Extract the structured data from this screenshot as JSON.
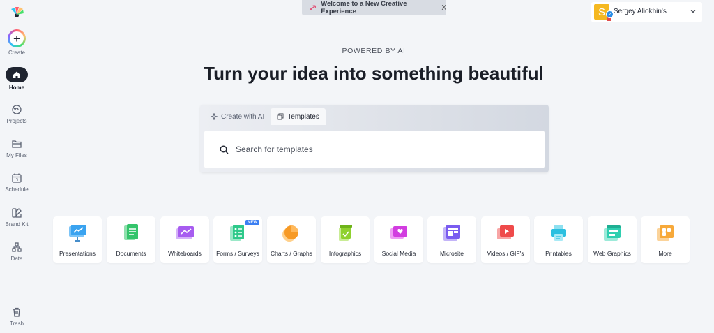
{
  "sidebar": {
    "items": [
      {
        "label": "Create",
        "icon": "plus-circle-icon"
      },
      {
        "label": "Home",
        "icon": "home-icon",
        "active": true
      },
      {
        "label": "Projects",
        "icon": "projects-icon"
      },
      {
        "label": "My Files",
        "icon": "folder-icon"
      },
      {
        "label": "Schedule",
        "icon": "calendar-icon"
      },
      {
        "label": "Brand Kit",
        "icon": "brand-kit-icon"
      },
      {
        "label": "Data",
        "icon": "data-icon"
      },
      {
        "label": "Trash",
        "icon": "trash-icon"
      }
    ]
  },
  "banner": {
    "text": "Welcome to a New Creative Experience",
    "close": "X"
  },
  "user": {
    "initial": "S",
    "name": "Sergey Aliokhin's"
  },
  "hero": {
    "powered_by": "POWERED BY AI",
    "title": "Turn your idea into something beautiful"
  },
  "search": {
    "tabs": [
      {
        "label": "Create with AI",
        "icon": "sparkle-icon"
      },
      {
        "label": "Templates",
        "icon": "templates-icon",
        "active": true
      }
    ],
    "placeholder": "Search for templates"
  },
  "categories": [
    {
      "label": "Presentations",
      "icon": "presentation-icon",
      "color": "#3aa3f0"
    },
    {
      "label": "Documents",
      "icon": "document-icon",
      "color": "#34c46b"
    },
    {
      "label": "Whiteboards",
      "icon": "whiteboard-icon",
      "color": "#a75cf0"
    },
    {
      "label": "Forms / Surveys",
      "icon": "form-icon",
      "color": "#2ec98a",
      "badge": "NEW"
    },
    {
      "label": "Charts / Graphs",
      "icon": "chart-icon",
      "color": "#f79a25"
    },
    {
      "label": "Infographics",
      "icon": "infographic-icon",
      "color": "#8fd12f"
    },
    {
      "label": "Social Media",
      "icon": "social-media-icon",
      "color": "#d23de0"
    },
    {
      "label": "Microsite",
      "icon": "microsite-icon",
      "color": "#7a5cf0"
    },
    {
      "label": "Videos / GIF's",
      "icon": "video-icon",
      "color": "#ef4a4a"
    },
    {
      "label": "Printables",
      "icon": "printer-icon",
      "color": "#2cc0e0"
    },
    {
      "label": "Web Graphics",
      "icon": "web-graphic-icon",
      "color": "#2fcfb0"
    },
    {
      "label": "More",
      "icon": "more-icon",
      "color": "#f7a93a"
    }
  ],
  "colors": {
    "accent": "#3b7ff2",
    "background": "#f3f5f8"
  }
}
